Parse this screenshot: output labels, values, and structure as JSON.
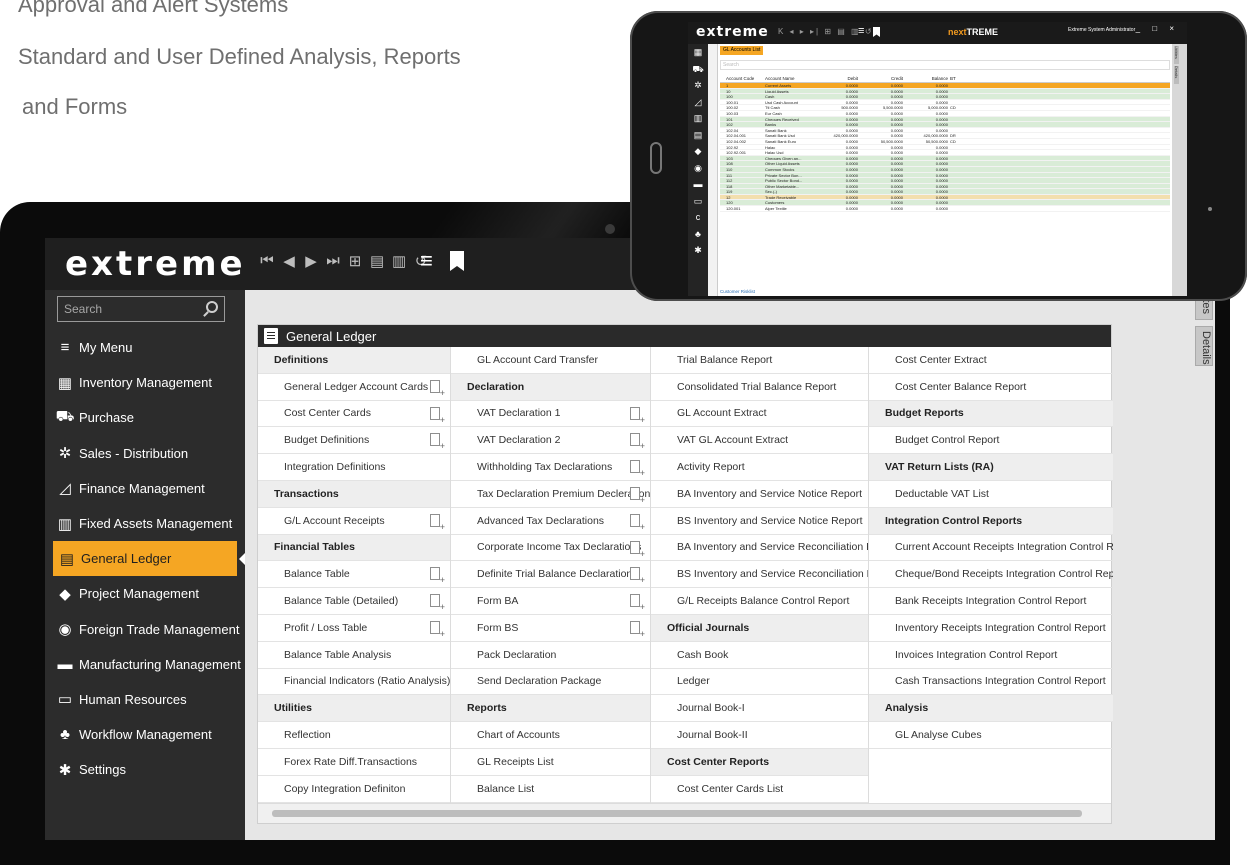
{
  "marketing": {
    "line1": "Approval and Alert Systems",
    "line2": "Standard and User Defined Analysis, Reports",
    "line3": "and Forms"
  },
  "app": {
    "logo": "extreme",
    "toolbar_icons": [
      "first-record-icon",
      "previous-record-icon",
      "next-record-icon",
      "last-record-icon",
      "new-icon",
      "save-icon",
      "delete-icon",
      "undo-icon"
    ],
    "menu_icon": "hamburger-icon",
    "bookmark_icon": "bookmark-icon"
  },
  "sidebar": {
    "search_placeholder": "Search",
    "items": [
      {
        "label": "My Menu",
        "icon": "my-menu-icon"
      },
      {
        "label": "Inventory Management",
        "icon": "inventory-icon"
      },
      {
        "label": "Purchase",
        "icon": "cart-icon"
      },
      {
        "label": "Sales - Distribution",
        "icon": "sales-icon"
      },
      {
        "label": "Finance Management",
        "icon": "finance-chart-icon"
      },
      {
        "label": "Fixed Assets Management",
        "icon": "fixed-assets-icon"
      },
      {
        "label": "General Ledger",
        "icon": "ledger-icon",
        "active": true
      },
      {
        "label": "Project Management",
        "icon": "project-icon"
      },
      {
        "label": "Foreign Trade Management",
        "icon": "globe-icon"
      },
      {
        "label": "Manufacturing Management",
        "icon": "factory-icon"
      },
      {
        "label": "Human Resources",
        "icon": "id-card-icon"
      },
      {
        "label": "Workflow Management",
        "icon": "workflow-icon"
      },
      {
        "label": "Settings",
        "icon": "gear-icon"
      }
    ]
  },
  "right_tabs": [
    "ilites",
    "Details"
  ],
  "panel": {
    "title": "General Ledger",
    "columns": [
      [
        {
          "text": "Definitions",
          "head": true
        },
        {
          "text": "General Ledger Account Cards",
          "add": true
        },
        {
          "text": "Cost Center Cards",
          "add": true
        },
        {
          "text": "Budget Definitions",
          "add": true
        },
        {
          "text": "Integration Definitions"
        },
        {
          "text": "Transactions",
          "head": true
        },
        {
          "text": "G/L Account Receipts",
          "add": true
        },
        {
          "text": "Financial Tables",
          "head": true
        },
        {
          "text": "Balance Table",
          "add": true
        },
        {
          "text": "Balance Table (Detailed)",
          "add": true
        },
        {
          "text": "Profit / Loss Table",
          "add": true
        },
        {
          "text": "Balance Table Analysis"
        },
        {
          "text": "Financial Indicators (Ratio Analysis)"
        },
        {
          "text": "Utilities",
          "head": true
        },
        {
          "text": "Reflection"
        },
        {
          "text": "Forex Rate Diff.Transactions"
        },
        {
          "text": "Copy Integration Definiton"
        }
      ],
      [
        {
          "text": "GL Account Card Transfer"
        },
        {
          "text": "Declaration",
          "head": true
        },
        {
          "text": "VAT Declaration 1",
          "add": true
        },
        {
          "text": "VAT Declaration 2",
          "add": true
        },
        {
          "text": "Withholding Tax Declarations",
          "add": true
        },
        {
          "text": "Tax Declaration Premium Decleration",
          "add": true
        },
        {
          "text": "Advanced Tax Declarations",
          "add": true
        },
        {
          "text": "Corporate Income Tax Declarations",
          "add": true
        },
        {
          "text": "Definite Trial Balance Declarations",
          "add": true
        },
        {
          "text": "Form BA",
          "add": true
        },
        {
          "text": "Form BS",
          "add": true
        },
        {
          "text": "Pack Declaration"
        },
        {
          "text": "Send Declaration Package"
        },
        {
          "text": "Reports",
          "head": true
        },
        {
          "text": "Chart of Accounts"
        },
        {
          "text": "GL Receipts List"
        },
        {
          "text": "Balance List"
        }
      ],
      [
        {
          "text": "Trial Balance Report"
        },
        {
          "text": "Consolidated Trial Balance Report"
        },
        {
          "text": "GL Account Extract"
        },
        {
          "text": "VAT GL Account Extract"
        },
        {
          "text": "Activity Report"
        },
        {
          "text": "BA Inventory and Service Notice Report"
        },
        {
          "text": "BS Inventory and Service Notice Report"
        },
        {
          "text": "BA Inventory and Service Reconciliation Form"
        },
        {
          "text": "BS Inventory and Service Reconciliation Form"
        },
        {
          "text": "G/L Receipts Balance Control Report"
        },
        {
          "text": "Official Journals",
          "head": true
        },
        {
          "text": "Cash Book"
        },
        {
          "text": "Ledger"
        },
        {
          "text": "Journal Book-I"
        },
        {
          "text": "Journal Book-II"
        },
        {
          "text": "Cost Center Reports",
          "head": true
        },
        {
          "text": "Cost Center Cards List"
        }
      ],
      [
        {
          "text": "Cost Center Extract"
        },
        {
          "text": "Cost Center Balance Report"
        },
        {
          "text": "Budget Reports",
          "head": true
        },
        {
          "text": "Budget Control Report"
        },
        {
          "text": "VAT Return Lists (RA)",
          "head": true
        },
        {
          "text": "Deductable VAT List"
        },
        {
          "text": "Integration Control Reports",
          "head": true
        },
        {
          "text": "Current Account Receipts Integration Control Repo"
        },
        {
          "text": "Cheque/Bond Receipts Integration Control Report"
        },
        {
          "text": "Bank Receipts Integration Control Report"
        },
        {
          "text": "Inventory Receipts Integration Control Report"
        },
        {
          "text": "Invoices Integration Control Report"
        },
        {
          "text": "Cash Transactions Integration Control Report"
        },
        {
          "text": "Analysis",
          "head": true
        },
        {
          "text": "GL Analyse Cubes"
        },
        {
          "text": ""
        },
        {
          "text": ""
        }
      ]
    ]
  },
  "mini": {
    "logo": "extreme",
    "nav": "K ◂ ▸ ▸| ⊞ ▤ ▥ ↺",
    "brand_a": "next",
    "brand_b": "TREME",
    "user": "Extreme System Administrator",
    "window_controls": "_ □ ×",
    "tab": "GL Accounts List",
    "search_placeholder": "Search",
    "headers": [
      "Account Code",
      "Account Name",
      "Debit",
      "Credit",
      "Balance",
      "BT"
    ],
    "rows": [
      {
        "c": [
          "1",
          "Current Assets",
          "0.0000",
          "0.0000",
          "0.0000",
          ""
        ],
        "k": "y"
      },
      {
        "c": [
          "10",
          "Liquid Assets",
          "0.0000",
          "0.0000",
          "0.0000",
          ""
        ],
        "k": "g"
      },
      {
        "c": [
          "100",
          "Cash",
          "0.0000",
          "0.0000",
          "0.0000",
          ""
        ],
        "k": "g"
      },
      {
        "c": [
          "100.01",
          "Usd Cash Account",
          "0.0000",
          "0.0000",
          "0.0000",
          ""
        ],
        "k": ""
      },
      {
        "c": [
          "100.02",
          "Ttl Cash",
          "500.0000",
          "5,500.0000",
          "5,000.0000",
          "CD"
        ],
        "k": ""
      },
      {
        "c": [
          "100.03",
          "Eur Cash",
          "0.0000",
          "0.0000",
          "0.0000",
          ""
        ],
        "k": ""
      },
      {
        "c": [
          "101",
          "Cheques Received",
          "0.0000",
          "0.0000",
          "0.0000",
          ""
        ],
        "k": "g"
      },
      {
        "c": [
          "102",
          "Banks",
          "0.0000",
          "0.0000",
          "0.0000",
          ""
        ],
        "k": "g"
      },
      {
        "c": [
          "102.04",
          "Sanati Bank",
          "0.0000",
          "0.0000",
          "0.0000",
          ""
        ],
        "k": ""
      },
      {
        "c": [
          "102.04.001",
          "Sanati Bank Usd",
          "420,000.0000",
          "0.0000",
          "420,000.0000",
          "DR"
        ],
        "k": ""
      },
      {
        "c": [
          "102.04.002",
          "Sanati Bank Euro",
          "0.0000",
          "50,500.0000",
          "50,500.0000",
          "CD"
        ],
        "k": ""
      },
      {
        "c": [
          "102.92",
          "Halac",
          "0.0000",
          "0.0000",
          "0.0000",
          ""
        ],
        "k": ""
      },
      {
        "c": [
          "102.92.001",
          "Halac Usd",
          "0.0000",
          "0.0000",
          "0.0000",
          ""
        ],
        "k": ""
      },
      {
        "c": [
          "103",
          "Cheques Given an...",
          "0.0000",
          "0.0000",
          "0.0000",
          ""
        ],
        "k": "g"
      },
      {
        "c": [
          "108",
          "Other Liquid Assets",
          "0.0000",
          "0.0000",
          "0.0000",
          ""
        ],
        "k": "g"
      },
      {
        "c": [
          "110",
          "Common Stocks",
          "0.0000",
          "0.0000",
          "0.0000",
          ""
        ],
        "k": "g"
      },
      {
        "c": [
          "111",
          "Private Sector Bon...",
          "0.0000",
          "0.0000",
          "0.0000",
          ""
        ],
        "k": "g"
      },
      {
        "c": [
          "112",
          "Public Sector Bond...",
          "0.0000",
          "0.0000",
          "0.0000",
          ""
        ],
        "k": "g"
      },
      {
        "c": [
          "118",
          "Other Marketable...",
          "0.0000",
          "0.0000",
          "0.0000",
          ""
        ],
        "k": "g"
      },
      {
        "c": [
          "119",
          "Sec.(-)",
          "0.0000",
          "0.0000",
          "0.0000",
          ""
        ],
        "k": "g"
      },
      {
        "c": [
          "12",
          "Trade Receivable",
          "0.0000",
          "0.0000",
          "0.0000",
          ""
        ],
        "k": "t"
      },
      {
        "c": [
          "120",
          "Customers",
          "0.0000",
          "0.0000",
          "0.0000",
          ""
        ],
        "k": "g"
      },
      {
        "c": [
          "120.001",
          "Alper Textile",
          "0.0000",
          "0.0000",
          "0.0000",
          ""
        ],
        "k": ""
      }
    ],
    "footer": "Customer Risklist",
    "right_tabs": [
      "Utilities",
      "Details"
    ]
  }
}
